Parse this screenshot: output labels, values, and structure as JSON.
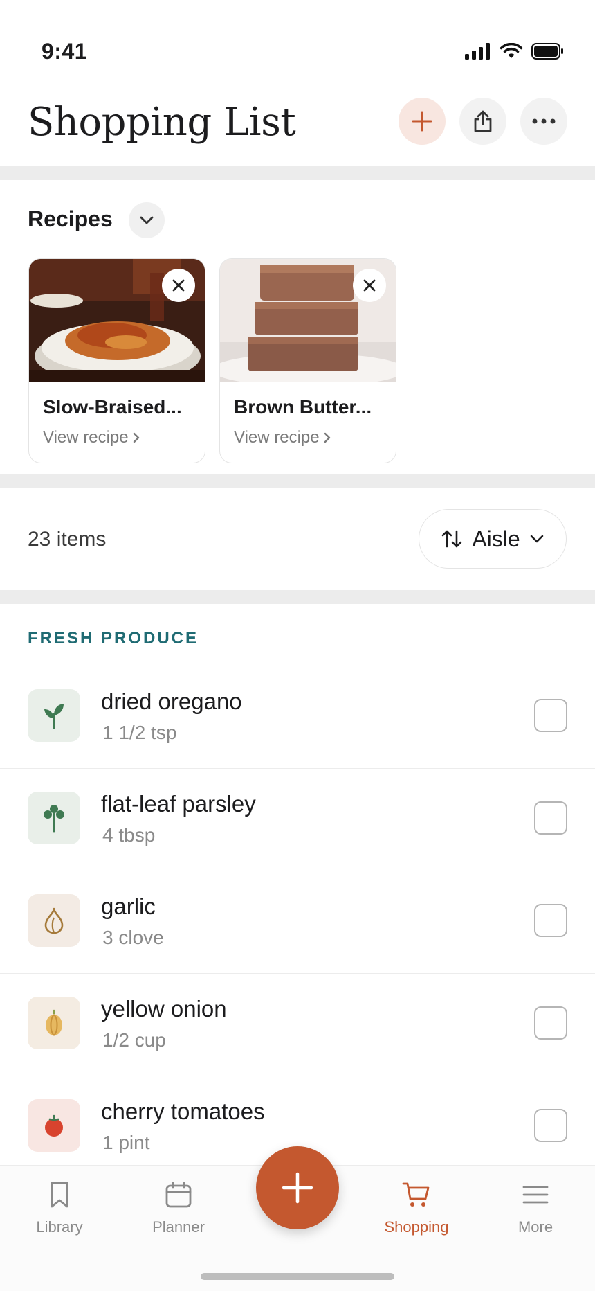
{
  "status_bar": {
    "time": "9:41"
  },
  "header": {
    "title": "Shopping List"
  },
  "recipes": {
    "title": "Recipes",
    "cards": [
      {
        "name": "Slow-Braised...",
        "link": "View recipe"
      },
      {
        "name": "Brown Butter...",
        "link": "View recipe"
      }
    ]
  },
  "list_meta": {
    "count": "23 items",
    "sort_label": "Aisle"
  },
  "section": {
    "label": "FRESH PRODUCE"
  },
  "items": [
    {
      "name": "dried oregano",
      "qty": "1 1/2 tsp",
      "icon": "sprout-icon",
      "bg": "#e9efe9"
    },
    {
      "name": "flat-leaf parsley",
      "qty": "4 tbsp",
      "icon": "herb-icon",
      "bg": "#e9efe9"
    },
    {
      "name": "garlic",
      "qty": "3 clove",
      "icon": "garlic-icon",
      "bg": "#f3ebe4"
    },
    {
      "name": "yellow onion",
      "qty": "1/2 cup",
      "icon": "onion-icon",
      "bg": "#f4ece2"
    },
    {
      "name": "cherry tomatoes",
      "qty": "1 pint",
      "icon": "tomato-icon",
      "bg": "#f8e6e2"
    }
  ],
  "tabs": [
    {
      "label": "Library",
      "icon": "bookmark-icon"
    },
    {
      "label": "Planner",
      "icon": "calendar-icon"
    },
    {
      "label": "Shopping",
      "icon": "cart-icon",
      "active": true
    },
    {
      "label": "More",
      "icon": "menu-icon"
    }
  ],
  "colors": {
    "accent": "#c4582f",
    "section_label": "#1f6b73"
  }
}
